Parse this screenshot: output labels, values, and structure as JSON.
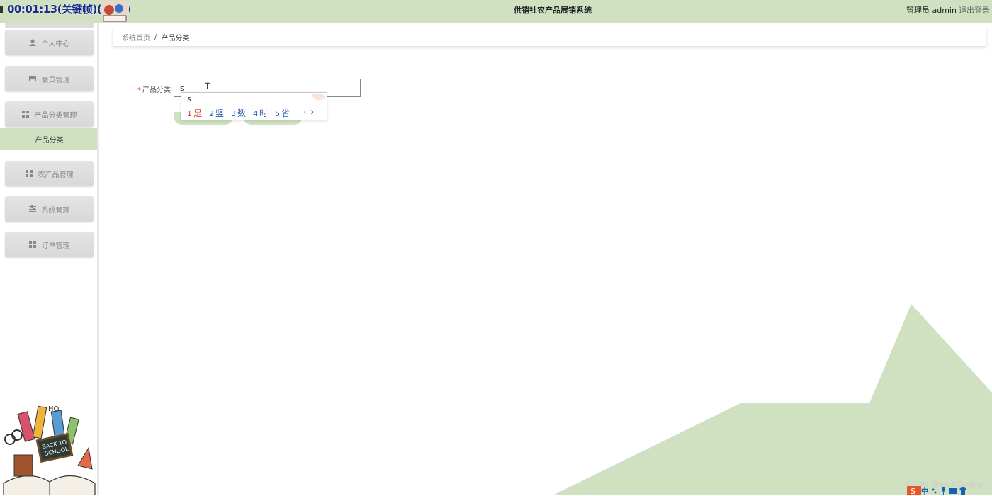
{
  "recording": {
    "timer_text": "00:01:13(关键帧)(19%)"
  },
  "header": {
    "title": "供销社农产品展销系统",
    "user_role": "管理员 admin",
    "logout_label": "退出登录"
  },
  "sidebar": {
    "items": [
      {
        "label": "个人中心",
        "icon": "user-icon"
      },
      {
        "label": "会员管理",
        "icon": "image-icon"
      },
      {
        "label": "产品分类管理",
        "icon": "grid-icon"
      },
      {
        "label": "农产品管理",
        "icon": "grid-icon"
      },
      {
        "label": "系统管理",
        "icon": "sliders-icon"
      },
      {
        "label": "订单管理",
        "icon": "grid-icon"
      }
    ],
    "active_submenu": "产品分类"
  },
  "breadcrumb": {
    "home": "系统首页",
    "separator": "/",
    "current": "产品分类"
  },
  "form": {
    "required_mark": "*",
    "field_label": "产品分类",
    "field_value": "s"
  },
  "ime": {
    "composition": "s",
    "candidates": [
      {
        "num": "1",
        "text": "是"
      },
      {
        "num": "2",
        "text": "竖"
      },
      {
        "num": "3",
        "text": "数"
      },
      {
        "num": "4",
        "text": "时"
      },
      {
        "num": "5",
        "text": "省"
      }
    ],
    "prev": "‹",
    "next": "›"
  },
  "footer": {
    "watermark": "CSDN @wishCoding",
    "ime_mode": "中"
  },
  "colors": {
    "accent": "#cfe1c1",
    "menu_bg": "#dcdcdc",
    "candidate_first": "#d0412b",
    "candidate": "#2a5db0"
  }
}
